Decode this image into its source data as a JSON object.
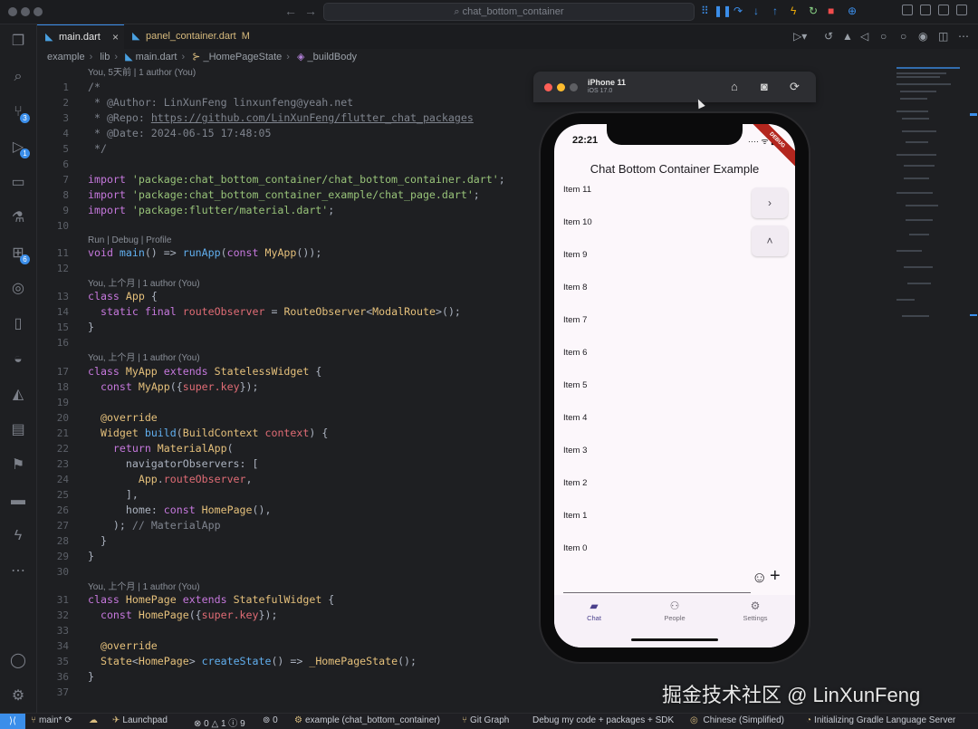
{
  "window": {
    "search_text": "chat_bottom_container",
    "nav_back": "←",
    "nav_forward": "→"
  },
  "tabs": [
    {
      "label": "main.dart",
      "active": true,
      "close": "×"
    },
    {
      "label": "panel_container.dart",
      "modified": "M"
    }
  ],
  "breadcrumb": [
    "example",
    "lib",
    "main.dart",
    "_HomePageState",
    "_buildBody"
  ],
  "code": {
    "lens_blame_top": "You, 5天前 | 1 author (You)",
    "lens_run": "Run | Debug | Profile",
    "lens_blame_app": "You, 上个月 | 1 author (You)",
    "lens_blame_myapp": "You, 上个月 | 1 author (You)",
    "lens_blame_home": "You, 上个月 | 1 author (You)",
    "l1": "/*",
    "l2": " * @Author: LinXunFeng linxunfeng@yeah.net",
    "l3a": " * @Repo: ",
    "l3b": "https://github.com/LinXunFeng/flutter_chat_packages",
    "l4": " * @Date: 2024-06-15 17:48:05",
    "l5": " */",
    "l7": "'package:chat_bottom_container/chat_bottom_container.dart'",
    "l8": "'package:chat_bottom_container_example/chat_page.dart'",
    "l9": "'package:flutter/material.dart'",
    "kw_import": "import",
    "kw_void": "void",
    "kw_main": "main",
    "kw_runapp": "runApp",
    "kw_const": "const",
    "kw_class": "class",
    "kw_static": "static",
    "kw_final": "final",
    "kw_extends": "extends",
    "kw_return": "return",
    "cls_myapp": "MyApp",
    "cls_app": "App",
    "cls_routeobserver": "RouteObserver",
    "cls_modalroute": "ModalRoute",
    "cls_stateless": "StatelessWidget",
    "cls_widget": "Widget",
    "cls_buildcontext": "BuildContext",
    "cls_materialapp": "MaterialApp",
    "cls_homepage": "HomePage",
    "cls_stateful": "StatefulWidget",
    "cls_state": "State",
    "cls_homepagestate": "_HomePageState",
    "id_routeobserver": "routeObserver",
    "id_super_key": "super.key",
    "id_override": "@override",
    "id_build": "build",
    "id_context": "context",
    "id_navobs": "navigatorObservers",
    "id_home": "home",
    "id_createstate": "createState",
    "cm_materialapp": "// MaterialApp"
  },
  "simulator": {
    "device": "iPhone 11",
    "os": "iOS 17.0",
    "time": "22:21",
    "status_icons": "···· ᯤ ▮",
    "debug": "DEBUG",
    "app_title": "Chat Bottom Container Example",
    "items": [
      "Item 11",
      "Item 10",
      "Item 9",
      "Item 8",
      "Item 7",
      "Item 6",
      "Item 5",
      "Item 4",
      "Item 3",
      "Item 2",
      "Item 1",
      "Item 0"
    ],
    "fab_forward": "›",
    "fab_up": "˄",
    "emoji": "☺",
    "plus": "+",
    "nav": [
      {
        "label": "Chat",
        "icon": "chat-icon"
      },
      {
        "label": "People",
        "icon": "people-icon"
      },
      {
        "label": "Settings",
        "icon": "settings-icon"
      }
    ]
  },
  "watermark": "掘金技术社区 @ LinXunFeng",
  "statusbar": {
    "branch": "main*",
    "launchpad": "Launchpad",
    "problems": "⊗ 0 △ 1 ⓘ 9",
    "ports": "0",
    "project": "example (chat_bottom_container)",
    "gitgraph": "Git Graph",
    "debug_mode": "Debug my code + packages + SDK",
    "language": "Chinese (Simplified)",
    "gradle": "Initializing Gradle Language Server"
  },
  "colors": {
    "accent": "#3b8eea",
    "debug_banner": "#b3261e"
  }
}
